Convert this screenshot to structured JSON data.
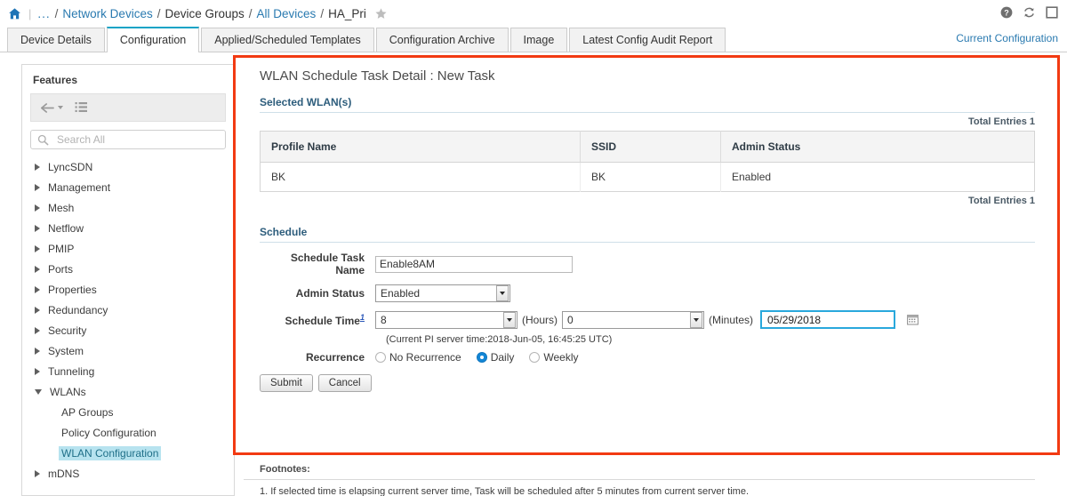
{
  "breadcrumb": {
    "home_icon": "home-icon",
    "dots": "...",
    "items": [
      {
        "label": "Network Devices",
        "link": true
      },
      {
        "label": "Device Groups",
        "link": false
      },
      {
        "label": "All Devices",
        "link": true
      },
      {
        "label": "HA_Pri",
        "link": false
      }
    ],
    "separator": "/",
    "star_icon": "star-icon"
  },
  "header_icons": [
    {
      "name": "help-icon",
      "glyph": "?"
    },
    {
      "name": "refresh-icon",
      "glyph": "refresh"
    },
    {
      "name": "panel-icon",
      "glyph": "square"
    }
  ],
  "tabs": [
    {
      "label": "Device Details",
      "active": false
    },
    {
      "label": "Configuration",
      "active": true
    },
    {
      "label": "Applied/Scheduled Templates",
      "active": false
    },
    {
      "label": "Configuration Archive",
      "active": false
    },
    {
      "label": "Image",
      "active": false
    },
    {
      "label": "Latest Config Audit Report",
      "active": false
    }
  ],
  "current_configuration_link": "Current Configuration",
  "sidebar": {
    "title": "Features",
    "toolbar": {
      "back_icon": "back-arrow-icon",
      "dropdown_icon": "chevron-down-icon",
      "list_icon": "list-view-icon"
    },
    "search": {
      "placeholder": "Search All",
      "value": "",
      "icon": "search-icon"
    },
    "tree": [
      {
        "label": "LyncSDN",
        "state": "collapsed",
        "child": false,
        "selected": false
      },
      {
        "label": "Management",
        "state": "collapsed",
        "child": false,
        "selected": false
      },
      {
        "label": "Mesh",
        "state": "collapsed",
        "child": false,
        "selected": false
      },
      {
        "label": "Netflow",
        "state": "collapsed",
        "child": false,
        "selected": false
      },
      {
        "label": "PMIP",
        "state": "collapsed",
        "child": false,
        "selected": false
      },
      {
        "label": "Ports",
        "state": "collapsed",
        "child": false,
        "selected": false
      },
      {
        "label": "Properties",
        "state": "collapsed",
        "child": false,
        "selected": false
      },
      {
        "label": "Redundancy",
        "state": "collapsed",
        "child": false,
        "selected": false
      },
      {
        "label": "Security",
        "state": "collapsed",
        "child": false,
        "selected": false
      },
      {
        "label": "System",
        "state": "collapsed",
        "child": false,
        "selected": false
      },
      {
        "label": "Tunneling",
        "state": "collapsed",
        "child": false,
        "selected": false
      },
      {
        "label": "WLANs",
        "state": "expanded",
        "child": false,
        "selected": false
      },
      {
        "label": "AP Groups",
        "state": "none",
        "child": true,
        "selected": false
      },
      {
        "label": "Policy Configuration",
        "state": "none",
        "child": true,
        "selected": false
      },
      {
        "label": "WLAN Configuration",
        "state": "none",
        "child": true,
        "selected": true
      },
      {
        "label": "mDNS",
        "state": "collapsed",
        "child": false,
        "selected": false
      }
    ]
  },
  "detail": {
    "title": "WLAN Schedule Task Detail :  New Task",
    "selected_wlans_heading": "Selected WLAN(s)",
    "total_entries_top": "Total Entries 1",
    "total_entries_bottom": "Total Entries 1",
    "table": {
      "columns": [
        "Profile Name",
        "SSID",
        "Admin Status"
      ],
      "rows": [
        [
          "BK",
          "BK",
          "Enabled"
        ]
      ]
    },
    "schedule_heading": "Schedule",
    "fields": {
      "task_name_label": "Schedule Task Name",
      "task_name_value": "Enable8AM",
      "admin_status_label": "Admin Status",
      "admin_status_value": "Enabled",
      "schedule_time_label": "Schedule Time",
      "schedule_time_footnote_marker": "1",
      "hours_value": "8",
      "hours_unit": "(Hours)",
      "minutes_value": "0",
      "minutes_unit": "(Minutes)",
      "date_value": "05/29/2018",
      "calendar_icon": "calendar-icon",
      "server_time_note": "(Current PI server time:2018-Jun-05, 16:45:25 UTC)",
      "recurrence_label": "Recurrence",
      "recurrence_options": [
        {
          "label": "No Recurrence",
          "checked": false
        },
        {
          "label": "Daily",
          "checked": true
        },
        {
          "label": "Weekly",
          "checked": false
        }
      ]
    },
    "buttons": {
      "submit": "Submit",
      "cancel": "Cancel"
    }
  },
  "footnotes": {
    "title": "Footnotes:",
    "text": "1. If selected time is elapsing current server time, Task will be scheduled after 5 minutes from current server time."
  },
  "colors": {
    "accent_blue": "#2a7ab0",
    "active_tab_border": "#12a3c6",
    "highlight_red": "#f23a12",
    "selection_teal": "#b7e3ef",
    "focus_blue": "#29a8dc",
    "radio_blue": "#1386d6"
  }
}
